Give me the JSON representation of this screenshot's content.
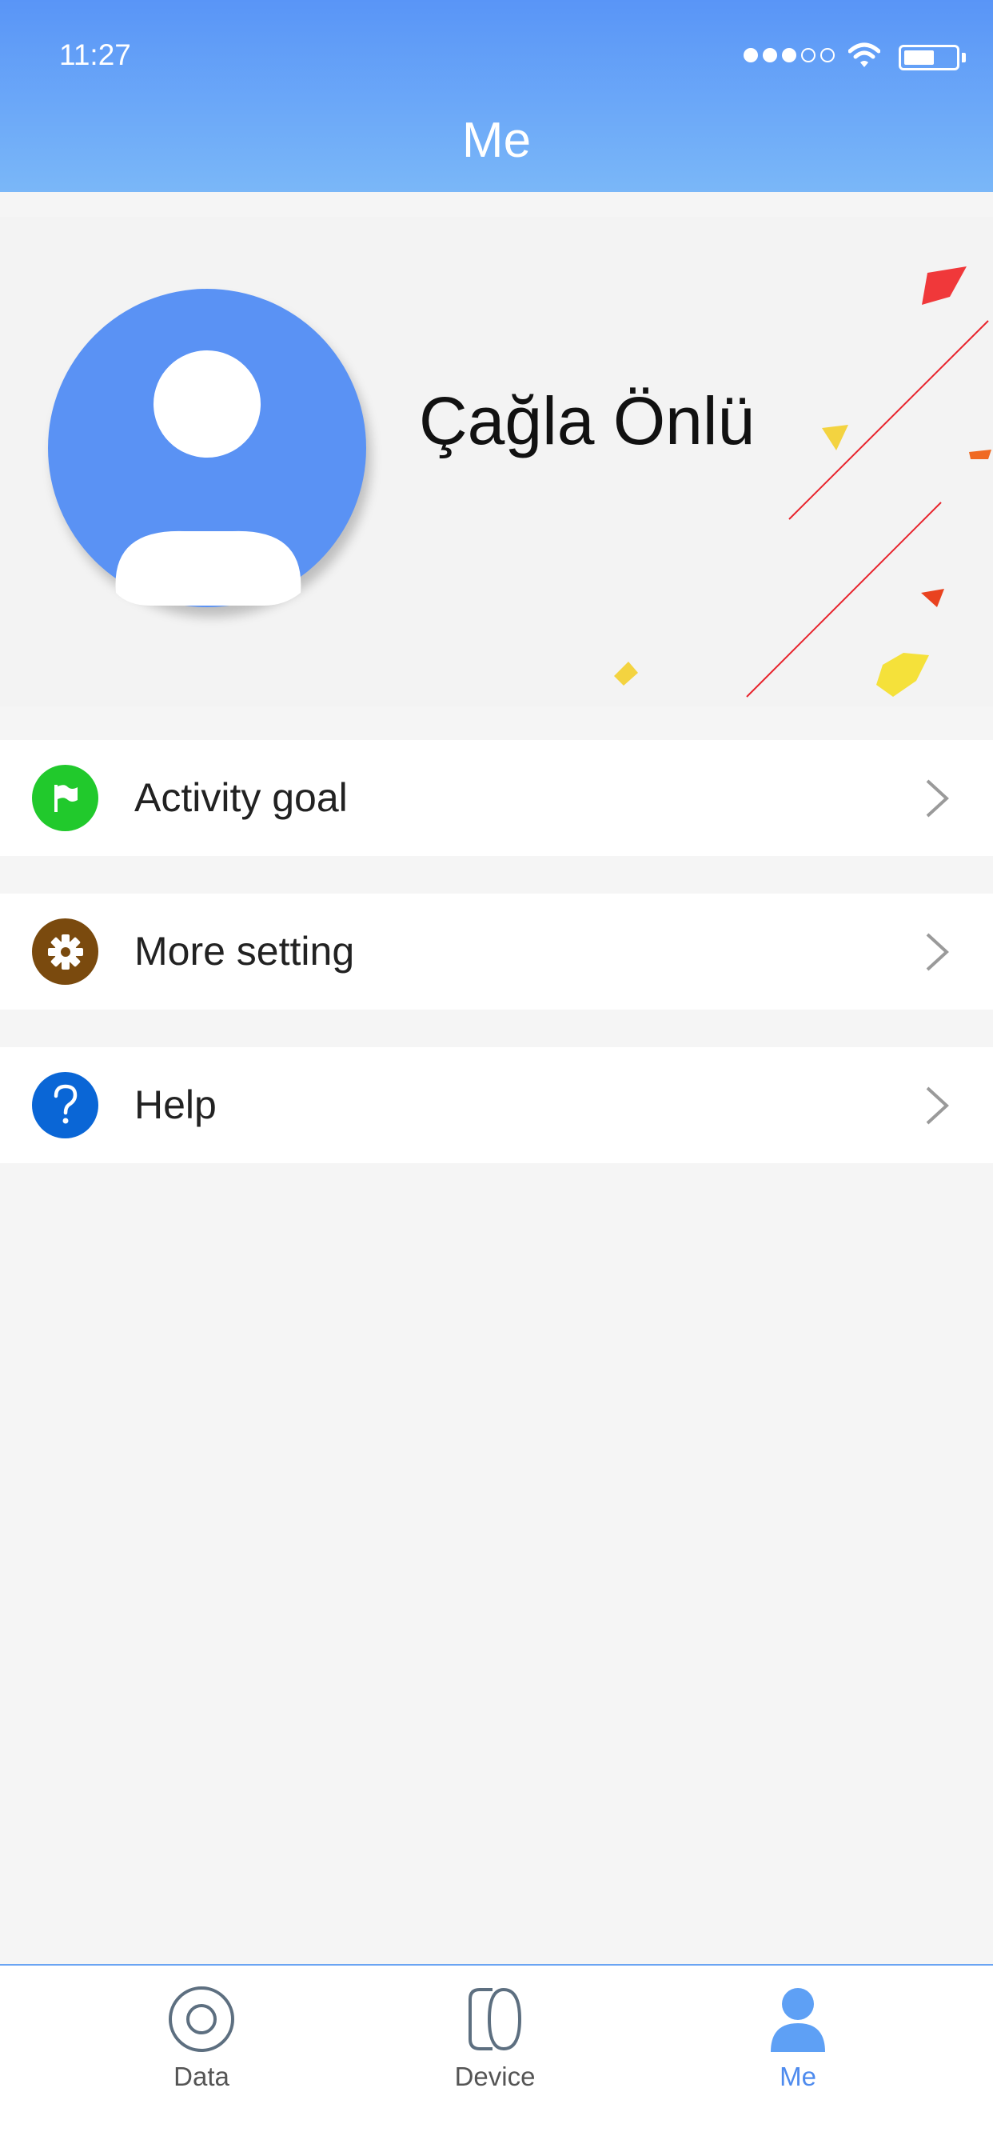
{
  "status_bar": {
    "time": "11:27",
    "battery_level": 0.6
  },
  "header": {
    "title": "Me"
  },
  "profile": {
    "name": "Çağla Önlü"
  },
  "menu": [
    {
      "label": "Activity goal",
      "icon": "flag-icon",
      "icon_color": "#21c92c"
    },
    {
      "label": "More setting",
      "icon": "gear-icon",
      "icon_color": "#7a4a0e"
    },
    {
      "label": "Help",
      "icon": "question-icon",
      "icon_color": "#0a66d6"
    }
  ],
  "tabs": [
    {
      "label": "Data",
      "icon": "data-ring-icon",
      "active": false
    },
    {
      "label": "Device",
      "icon": "device-icon",
      "active": false
    },
    {
      "label": "Me",
      "icon": "person-icon",
      "active": true
    }
  ],
  "colors": {
    "accent": "#5a92f4",
    "tab_active": "#4e8bee",
    "background": "#f5f5f5"
  }
}
